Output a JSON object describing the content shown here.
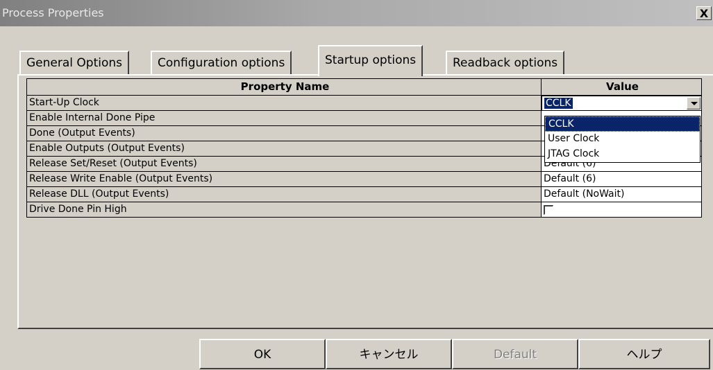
{
  "window": {
    "title": "Process Properties",
    "close_label": "X"
  },
  "tabs": [
    {
      "label": "General Options",
      "active": false
    },
    {
      "label": "Configuration options",
      "active": false
    },
    {
      "label": "Startup options",
      "active": true
    },
    {
      "label": "Readback options",
      "active": false
    }
  ],
  "table": {
    "headers": {
      "property": "Property Name",
      "value": "Value"
    },
    "rows": [
      {
        "name": "Start-Up Clock",
        "value": "CCLK"
      },
      {
        "name": "Enable Internal Done Pipe",
        "value": ""
      },
      {
        "name": "Done (Output Events)",
        "value": ""
      },
      {
        "name": "Enable Outputs (Output Events)",
        "value": ""
      },
      {
        "name": "Release Set/Reset (Output Events)",
        "value": "Default (6)"
      },
      {
        "name": "Release Write Enable (Output Events)",
        "value": "Default (6)"
      },
      {
        "name": "Release DLL (Output Events)",
        "value": "Default (NoWait)"
      },
      {
        "name": "Drive Done Pin High",
        "value": ""
      }
    ]
  },
  "dropdown": {
    "selected": "CCLK",
    "options": [
      "CCLK",
      "User Clock",
      "JTAG Clock"
    ]
  },
  "buttons": {
    "ok": "OK",
    "cancel": "キャンセル",
    "default": "Default",
    "help": "ヘルプ"
  },
  "colors": {
    "face": "#d4d0c8",
    "highlight": "#0a246a"
  }
}
